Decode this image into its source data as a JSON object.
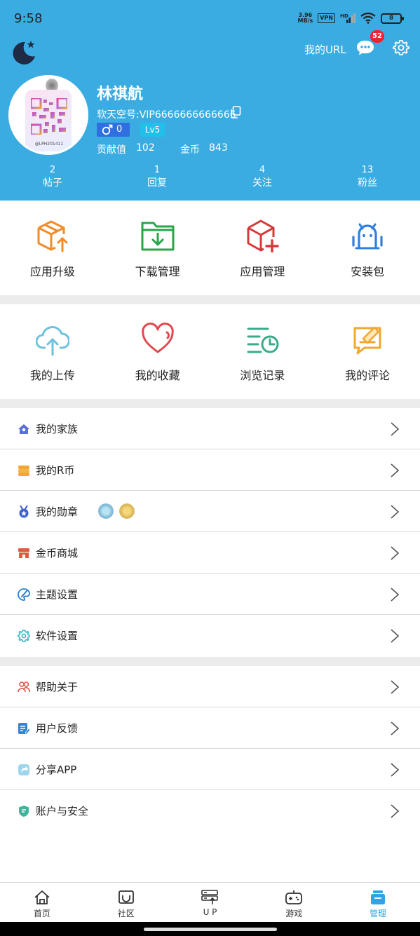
{
  "status_bar": {
    "time": "9:58",
    "net_speed_value": "3.96",
    "net_speed_unit": "MB/s",
    "vpn": "VPN",
    "hd": "HD",
    "battery": "8"
  },
  "header": {
    "url_label": "我的URL",
    "message_badge": "52",
    "username": "林祺航",
    "account_id": "软天空号:VIP6666666666666",
    "gender_value": "0",
    "level": "Lv5",
    "contribution_label": "贡献值",
    "contribution_value": "102",
    "coins_label": "金币",
    "coins_value": "843",
    "avatar_tag": "@LPH201411",
    "counts": [
      {
        "value": "2",
        "label": "帖子"
      },
      {
        "value": "1",
        "label": "回复"
      },
      {
        "value": "4",
        "label": "关注"
      },
      {
        "value": "13",
        "label": "粉丝"
      }
    ],
    "bg_color": "#3aace2"
  },
  "grid1": [
    {
      "label": "应用升级",
      "icon": "box-upgrade-icon"
    },
    {
      "label": "下载管理",
      "icon": "folder-download-icon"
    },
    {
      "label": "应用管理",
      "icon": "box-add-icon"
    },
    {
      "label": "安装包",
      "icon": "android-package-icon"
    }
  ],
  "grid2": [
    {
      "label": "我的上传",
      "icon": "cloud-upload-icon"
    },
    {
      "label": "我的收藏",
      "icon": "heart-icon"
    },
    {
      "label": "浏览记录",
      "icon": "history-icon"
    },
    {
      "label": "我的评论",
      "icon": "comment-edit-icon"
    }
  ],
  "menu1": [
    {
      "label": "我的家族",
      "icon": "family-house-icon"
    },
    {
      "label": "我的R币",
      "icon": "coin-stack-icon"
    },
    {
      "label": "我的勋章",
      "icon": "medal-icon"
    },
    {
      "label": "金币商城",
      "icon": "store-icon"
    },
    {
      "label": "主题设置",
      "icon": "palette-icon"
    },
    {
      "label": "软件设置",
      "icon": "settings-icon"
    }
  ],
  "menu2": [
    {
      "label": "帮助关于",
      "icon": "help-people-icon"
    },
    {
      "label": "用户反馈",
      "icon": "feedback-icon"
    },
    {
      "label": "分享APP",
      "icon": "share-icon"
    },
    {
      "label": "账户与安全",
      "icon": "shield-icon"
    }
  ],
  "bottom_nav": [
    {
      "label": "首页",
      "icon": "home-icon"
    },
    {
      "label": "社区",
      "icon": "community-icon"
    },
    {
      "label": "U P",
      "icon": "upload-server-icon"
    },
    {
      "label": "游戏",
      "icon": "gamepad-icon"
    },
    {
      "label": "管理",
      "icon": "manage-icon",
      "active": true
    }
  ],
  "accent_color": "#2ea6e6"
}
